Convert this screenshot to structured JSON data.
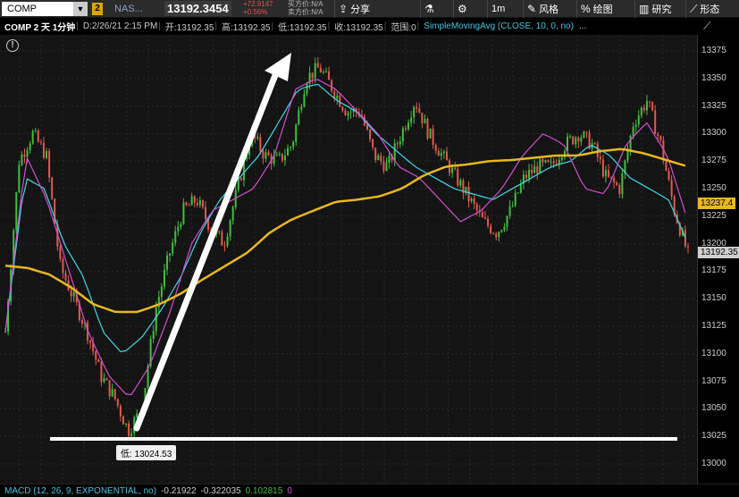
{
  "toolbar": {
    "symbol": "COMP",
    "link_number": "2",
    "name": "NAS...",
    "price": "13192.3454",
    "change": "+72.9147",
    "change_pct": "+0.56%",
    "bid": "买方价:N/A",
    "ask": "卖方价:N/A",
    "buttons": [
      {
        "icon": "share-icon",
        "glyph": "⇪",
        "label": "分享"
      },
      {
        "icon": "flask-icon",
        "glyph": "⚗",
        "label": ""
      },
      {
        "icon": "gear-icon",
        "glyph": "⚙",
        "label": ""
      },
      {
        "icon": "timeframe",
        "glyph": "",
        "label": "1m"
      },
      {
        "icon": "style-icon",
        "glyph": "✎",
        "label": "风格"
      },
      {
        "icon": "percent-icon",
        "glyph": "%",
        "label": "绘图"
      },
      {
        "icon": "studies-icon",
        "glyph": "▥",
        "label": "研究"
      },
      {
        "icon": "patterns-icon",
        "glyph": "⟋",
        "label": "形态"
      }
    ]
  },
  "infobar": {
    "title": "COMP 2 天 1分钟",
    "date": "D:2/26/21 2:15 PM",
    "open": "开:13192.35",
    "high": "高:13192.35",
    "low": "低:13192.35",
    "close": "收:13192.35",
    "range": "范围:0",
    "study": "SimpleMovingAvg (CLOSE, 10, 0, no)",
    "dots": "..."
  },
  "low_marker": "低: 13024.53",
  "price_axis": {
    "ticks": [
      "13375",
      "13350",
      "13325",
      "13300",
      "13275",
      "13250",
      "13225",
      "13200",
      "13175",
      "13150",
      "13125",
      "13100",
      "13075",
      "13050",
      "13025",
      "13000"
    ],
    "tag_sma": "13237.4",
    "tag_last": "13192.35"
  },
  "bottom": {
    "label": "MACD (12, 26, 9, EXPONENTIAL, no)",
    "v1": "-0.21922",
    "v2": "-0.322035",
    "v3": "0.102815",
    "v4": "0"
  },
  "colors": {
    "up": "#3fbf3f",
    "down": "#e05a50",
    "sma_gold": "#e8b820",
    "ma_cyan": "#40d8e8",
    "ma_magenta": "#d050d0",
    "annotation": "#ffffff"
  },
  "chart_data": {
    "type": "candlestick",
    "ylim": [
      12990,
      13385
    ],
    "low": 13024.53,
    "last": 13192.35,
    "close_path": [
      13120,
      13275,
      13300,
      13280,
      13180,
      13150,
      13120,
      13080,
      13060,
      13030,
      13050,
      13140,
      13190,
      13230,
      13240,
      13215,
      13200,
      13250,
      13300,
      13280,
      13275,
      13290,
      13350,
      13360,
      13340,
      13320,
      13320,
      13280,
      13270,
      13300,
      13330,
      13300,
      13280,
      13260,
      13240,
      13220,
      13210,
      13230,
      13260,
      13270,
      13270,
      13290,
      13300,
      13290,
      13260,
      13250,
      13310,
      13330,
      13290,
      13230,
      13190
    ],
    "gold_path": [
      13180,
      13178,
      13172,
      13160,
      13145,
      13138,
      13138,
      13145,
      13155,
      13168,
      13180,
      13192,
      13210,
      13222,
      13230,
      13238,
      13240,
      13243,
      13250,
      13262,
      13270,
      13272,
      13275,
      13276,
      13278,
      13280,
      13280,
      13284,
      13286,
      13282,
      13276,
      13270
    ],
    "cyan_path": [
      13120,
      13260,
      13250,
      13200,
      13170,
      13120,
      13100,
      13115,
      13140,
      13170,
      13210,
      13240,
      13260,
      13280,
      13310,
      13340,
      13345,
      13330,
      13320,
      13300,
      13285,
      13270,
      13260,
      13250,
      13245,
      13240,
      13250,
      13260,
      13270,
      13275,
      13290,
      13280,
      13260,
      13250,
      13240,
      13200
    ],
    "magenta_path": [
      13120,
      13280,
      13240,
      13180,
      13120,
      13080,
      13060,
      13090,
      13140,
      13200,
      13230,
      13240,
      13250,
      13280,
      13340,
      13350,
      13340,
      13320,
      13300,
      13270,
      13260,
      13240,
      13220,
      13230,
      13250,
      13280,
      13300,
      13290,
      13250,
      13245,
      13290,
      13310,
      13280,
      13220
    ]
  }
}
